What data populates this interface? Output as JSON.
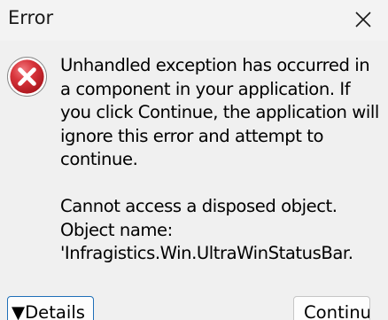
{
  "window": {
    "title": "Error"
  },
  "icons": {
    "error": "error-x-circle-icon",
    "close": "close-icon"
  },
  "colors": {
    "error_red": "#c8232b",
    "focus_border": "#1f6fb8"
  },
  "message": {
    "text": "Unhandled exception has occurred in a component in your application. If you click Continue, the application will ignore this error and attempt to continue.\n\nCannot access a disposed object. Object name: 'Infragistics.Win.UltraWinStatusBar."
  },
  "buttons": {
    "details_label": "▼Details",
    "continue_label": "Continue"
  }
}
